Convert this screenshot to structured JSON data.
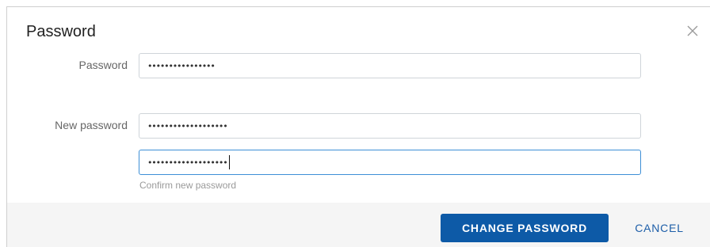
{
  "dialog": {
    "title": "Password",
    "close_icon": "close-icon"
  },
  "form": {
    "password_label": "Password",
    "password_value": "••••••••••••••••",
    "new_password_label": "New password",
    "new_password_value": "•••••••••••••••••••",
    "confirm_value": "•••••••••••••••••••",
    "confirm_helper": "Confirm new password"
  },
  "footer": {
    "change_label": "CHANGE PASSWORD",
    "cancel_label": "CANCEL"
  },
  "colors": {
    "primary": "#0d5aa7",
    "focus_border": "#3d8fd6",
    "footer_bg": "#f5f5f5"
  }
}
